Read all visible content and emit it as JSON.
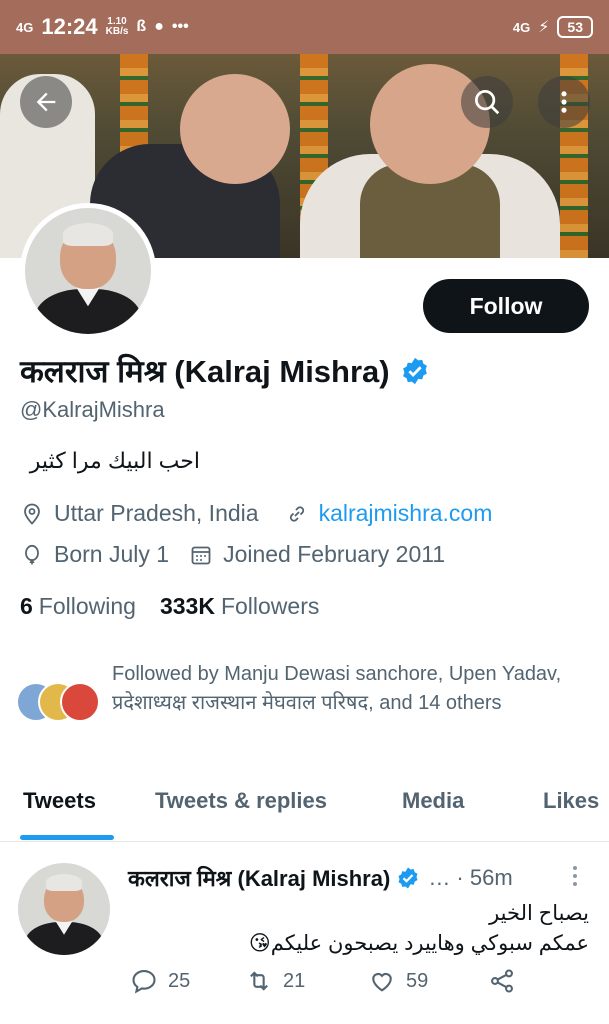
{
  "status_bar": {
    "network": "4G",
    "time": "12:24",
    "speed_value": "1.10",
    "speed_unit": "KB/s",
    "dots": "•••",
    "network_right": "4G",
    "battery": "53"
  },
  "profile": {
    "name": "कलराज मिश्र (Kalraj Mishra)",
    "handle": "@KalrajMishra",
    "bio": "احب البيك مرا كثير",
    "location": "Uttar Pradesh, India",
    "website": "kalrajmishra.com",
    "birthday": "Born July 1",
    "joined": "Joined February 2011",
    "following_count": "6",
    "following_label": "Following",
    "followers_count": "333K",
    "followers_label": "Followers",
    "follow_button": "Follow",
    "followed_by": "Followed by Manju Dewasi sanchore, Upen Yadav, प्रदेशाध्यक्ष राजस्थान मेघवाल परिषद, and 14 others"
  },
  "tabs": [
    {
      "label": "Tweets",
      "active": true
    },
    {
      "label": "Tweets & replies",
      "active": false
    },
    {
      "label": "Media",
      "active": false
    },
    {
      "label": "Likes",
      "active": false
    }
  ],
  "tweet": {
    "author": "कलराज मिश्र (Kalraj Mishra)",
    "meta": "… · 56m",
    "line1": "يصباح الخير",
    "line2": "عمكم سبوكي وهاييرد يصبحون عليكم😘",
    "replies": "25",
    "retweets": "21",
    "likes": "59"
  },
  "colors": {
    "status_bar": "#a36c5b",
    "accent": "#1d9bf0",
    "text_primary": "#0f1419",
    "text_secondary": "#536471"
  },
  "icons": [
    "back-arrow-icon",
    "search-icon",
    "more-vertical-icon",
    "verified-badge-icon",
    "location-pin-icon",
    "link-icon",
    "balloon-icon",
    "calendar-icon",
    "reply-icon",
    "retweet-icon",
    "like-icon",
    "share-icon"
  ]
}
